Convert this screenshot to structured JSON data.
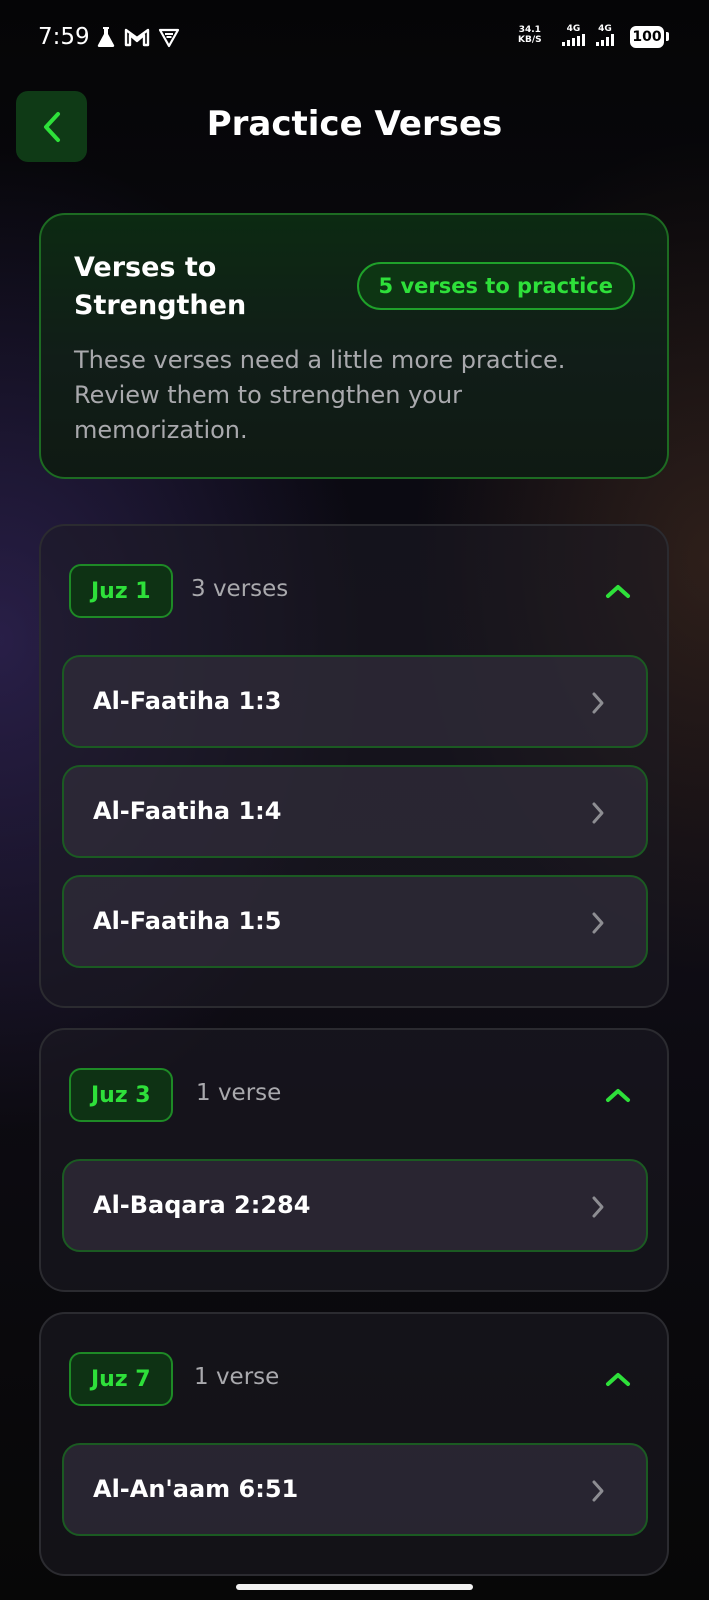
{
  "status_bar": {
    "time": "7:59",
    "net_speed_value": "34.1",
    "net_speed_unit": "KB/S",
    "signal1_label": "4G",
    "signal2_label": "4G",
    "battery": "100",
    "icons": [
      "flask-icon",
      "gmail-icon",
      "vpn-shield-icon"
    ]
  },
  "header": {
    "title": "Practice Verses",
    "back_icon": "chevron-left-icon"
  },
  "summary": {
    "title": "Verses to Strengthen",
    "badge": "5 verses to practice",
    "description": "These verses need a little more practice. Review them to strengthen your memorization."
  },
  "groups": [
    {
      "juz": "Juz 1",
      "count": "3 verses",
      "verses": [
        "Al-Faatiha 1:3",
        "Al-Faatiha 1:4",
        "Al-Faatiha 1:5"
      ]
    },
    {
      "juz": "Juz 3",
      "count": "1 verse",
      "verses": [
        "Al-Baqara 2:284"
      ]
    },
    {
      "juz": "Juz 7",
      "count": "1 verse",
      "verses": [
        "Al-An'aam 6:51"
      ]
    }
  ],
  "colors": {
    "accent": "#2ee03a",
    "accent_dark": "#0e3214",
    "background": "#0b0a12",
    "card_border": "#2b2b30",
    "muted_text": "#a9a9ad"
  }
}
